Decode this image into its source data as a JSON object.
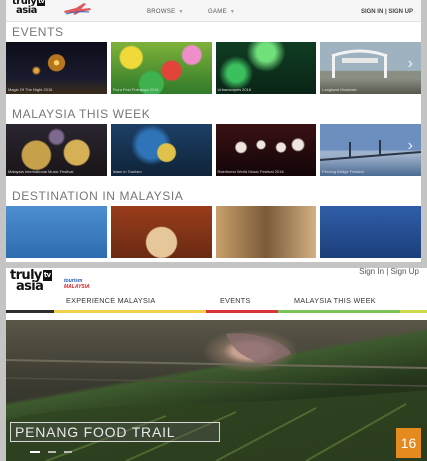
{
  "top": {
    "logo": {
      "word1": "truly",
      "badge": "tv",
      "word2": "asia"
    },
    "nav": [
      {
        "label": "BROWSE"
      },
      {
        "label": "GAME"
      }
    ],
    "auth": "SIGN IN | SIGN UP",
    "sections": [
      {
        "title": "EVENTS",
        "tiles": [
          {
            "caption": "Magic Of The Night 2016"
          },
          {
            "caption": "Flora Fest Putrajaya 2016"
          },
          {
            "caption": "Urbanscapes 2016"
          },
          {
            "caption": "Langkawi Mountain"
          }
        ]
      },
      {
        "title": "MALAYSIA THIS WEEK",
        "tiles": [
          {
            "caption": "Malaysia International Music Festival"
          },
          {
            "caption": "Islam in Tourism"
          },
          {
            "caption": "Rainforest World Music Festival 2016"
          },
          {
            "caption": "Penang Bridge Festival"
          }
        ]
      },
      {
        "title": "DESTINATION IN MALAYSIA",
        "tiles": [
          {
            "caption": ""
          },
          {
            "caption": ""
          },
          {
            "caption": ""
          },
          {
            "caption": ""
          }
        ]
      }
    ]
  },
  "bottom": {
    "logo": {
      "word1": "truly",
      "badge": "tv",
      "word2": "asia"
    },
    "tourism_logo": {
      "line1": "tourism",
      "line2": "MALAYSIA"
    },
    "auth": "Sign In | Sign Up",
    "nav": [
      {
        "label": "EXPERIENCE MALAYSIA"
      },
      {
        "label": "EVENTS"
      },
      {
        "label": "MALAYSIA THIS WEEK"
      }
    ],
    "nav_bar_colors": [
      "#2d2d2d",
      "#f0d24a",
      "#d9343a",
      "#7cc35a",
      "#cfd94e"
    ],
    "hero_title": "PENANG FOOD TRAIL"
  },
  "page_number": "16",
  "colors": {
    "accent": "#e58a1e",
    "tourism_blue": "#1a5ab0",
    "tourism_red": "#d8252a"
  }
}
